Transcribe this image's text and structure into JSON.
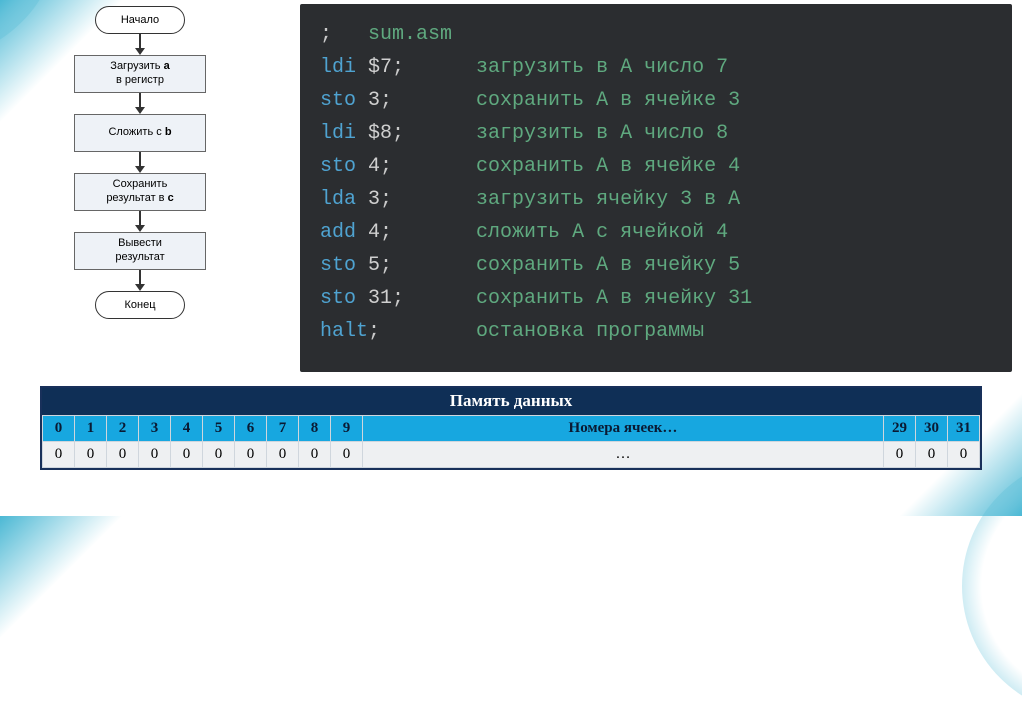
{
  "flow": {
    "start": "Начало",
    "step1_a": "Загрузить ",
    "step1_b": "a",
    "step1_c": "\nв регистр",
    "step2_a": "Сложить с ",
    "step2_b": "b",
    "step3_a": "Сохранить\nрезультат в ",
    "step3_b": "c",
    "step4": "Вывести\nрезультат",
    "end": "Конец"
  },
  "code": [
    {
      "mnem": ";",
      "arg": "",
      "sep": "   ",
      "cmt": "sum.asm"
    },
    {
      "mnem": "ldi",
      "arg": " $7",
      "sep": ";      ",
      "cmt": "загрузить в А число 7"
    },
    {
      "mnem": "sto",
      "arg": " 3",
      "sep": ";       ",
      "cmt": "сохранить А в ячейке 3"
    },
    {
      "mnem": "ldi",
      "arg": " $8",
      "sep": ";      ",
      "cmt": "загрузить в А число 8"
    },
    {
      "mnem": "sto",
      "arg": " 4",
      "sep": ";       ",
      "cmt": "сохранить А в ячейке 4"
    },
    {
      "mnem": "lda",
      "arg": " 3",
      "sep": ";       ",
      "cmt": "загрузить ячейку 3 в А"
    },
    {
      "mnem": "add",
      "arg": " 4",
      "sep": ";       ",
      "cmt": "сложить А с ячейкой 4"
    },
    {
      "mnem": "sto",
      "arg": " 5",
      "sep": ";       ",
      "cmt": "сохранить А в ячейку 5"
    },
    {
      "mnem": "sto",
      "arg": " 31",
      "sep": ";      ",
      "cmt": "сохранить А в ячейку 31"
    },
    {
      "mnem": "halt",
      "arg": "",
      "sep": ";        ",
      "cmt": "остановка программы"
    }
  ],
  "memory": {
    "title": "Память данных",
    "headers": [
      "0",
      "1",
      "2",
      "3",
      "4",
      "5",
      "6",
      "7",
      "8",
      "9",
      "Номера ячеек…",
      "29",
      "30",
      "31"
    ],
    "values": [
      "0",
      "0",
      "0",
      "0",
      "0",
      "0",
      "0",
      "0",
      "0",
      "0",
      "…",
      "0",
      "0",
      "0"
    ]
  }
}
